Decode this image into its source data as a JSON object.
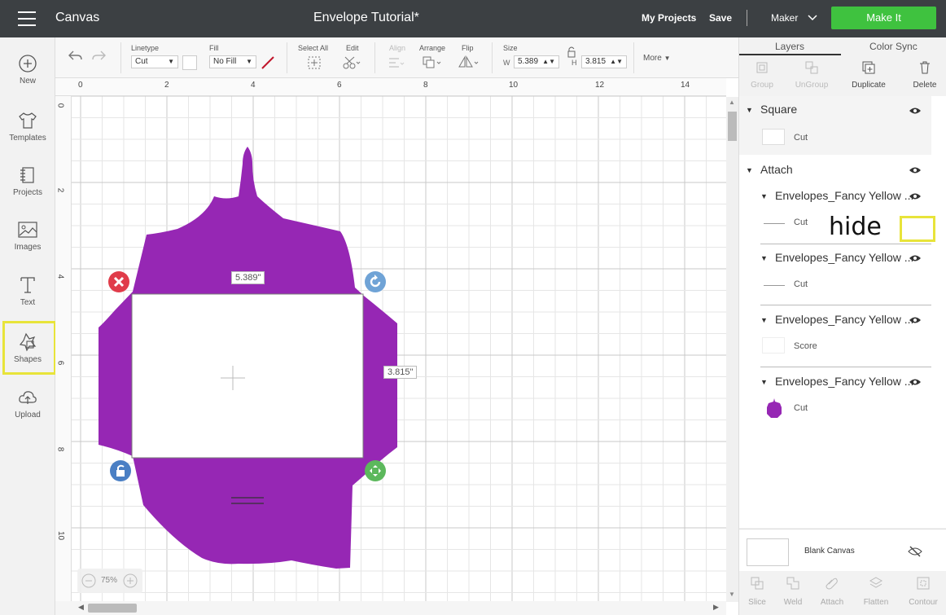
{
  "topbar": {
    "app_title": "Canvas",
    "doc_title": "Envelope Tutorial*",
    "my_projects": "My Projects",
    "save": "Save",
    "separator": "|",
    "machine": "Maker",
    "make_it": "Make It",
    "accent_color": "#3fc23f"
  },
  "sidebar": {
    "items": [
      {
        "label": "New",
        "icon": "plus-circle-icon"
      },
      {
        "label": "Templates",
        "icon": "tshirt-icon"
      },
      {
        "label": "Projects",
        "icon": "projects-icon"
      },
      {
        "label": "Images",
        "icon": "image-icon"
      },
      {
        "label": "Text",
        "icon": "text-icon"
      },
      {
        "label": "Shapes",
        "icon": "shapes-icon"
      },
      {
        "label": "Upload",
        "icon": "upload-cloud-icon"
      }
    ]
  },
  "toolbar": {
    "linetype_label": "Linetype",
    "linetype_value": "Cut",
    "fill_label": "Fill",
    "fill_value": "No Fill",
    "select_all": "Select All",
    "edit": "Edit",
    "align": "Align",
    "arrange": "Arrange",
    "flip": "Flip",
    "size": "Size",
    "w_label": "W",
    "w_value": "5.389",
    "h_label": "H",
    "h_value": "3.815",
    "more": "More"
  },
  "canvas": {
    "ruler_top": [
      "0",
      "2",
      "4",
      "6",
      "8",
      "10",
      "12",
      "14"
    ],
    "ruler_left": [
      "0",
      "2",
      "4",
      "6",
      "8",
      "10"
    ],
    "width_dim": "5.389\"",
    "height_dim": "3.815\"",
    "zoom": "75%",
    "envelope_color": "#9627b4"
  },
  "panel": {
    "tab_layers": "Layers",
    "tab_color_sync": "Color Sync",
    "actions": {
      "group": "Group",
      "ungroup": "UnGroup",
      "duplicate": "Duplicate",
      "delete": "Delete"
    },
    "layers": [
      {
        "name": "Square",
        "op": "Cut"
      },
      {
        "name": "Attach"
      },
      {
        "name": "Envelopes_Fancy Yellow ...",
        "op": "Cut"
      },
      {
        "name": "Envelopes_Fancy Yellow ...",
        "op": "Cut"
      },
      {
        "name": "Envelopes_Fancy Yellow ...",
        "op": "Score"
      },
      {
        "name": "Envelopes_Fancy Yellow ...",
        "op": "Cut"
      }
    ],
    "annotation_hide": "hide",
    "blank_canvas": "Blank Canvas",
    "bottom_actions": {
      "slice": "Slice",
      "weld": "Weld",
      "attach": "Attach",
      "flatten": "Flatten",
      "contour": "Contour"
    }
  }
}
